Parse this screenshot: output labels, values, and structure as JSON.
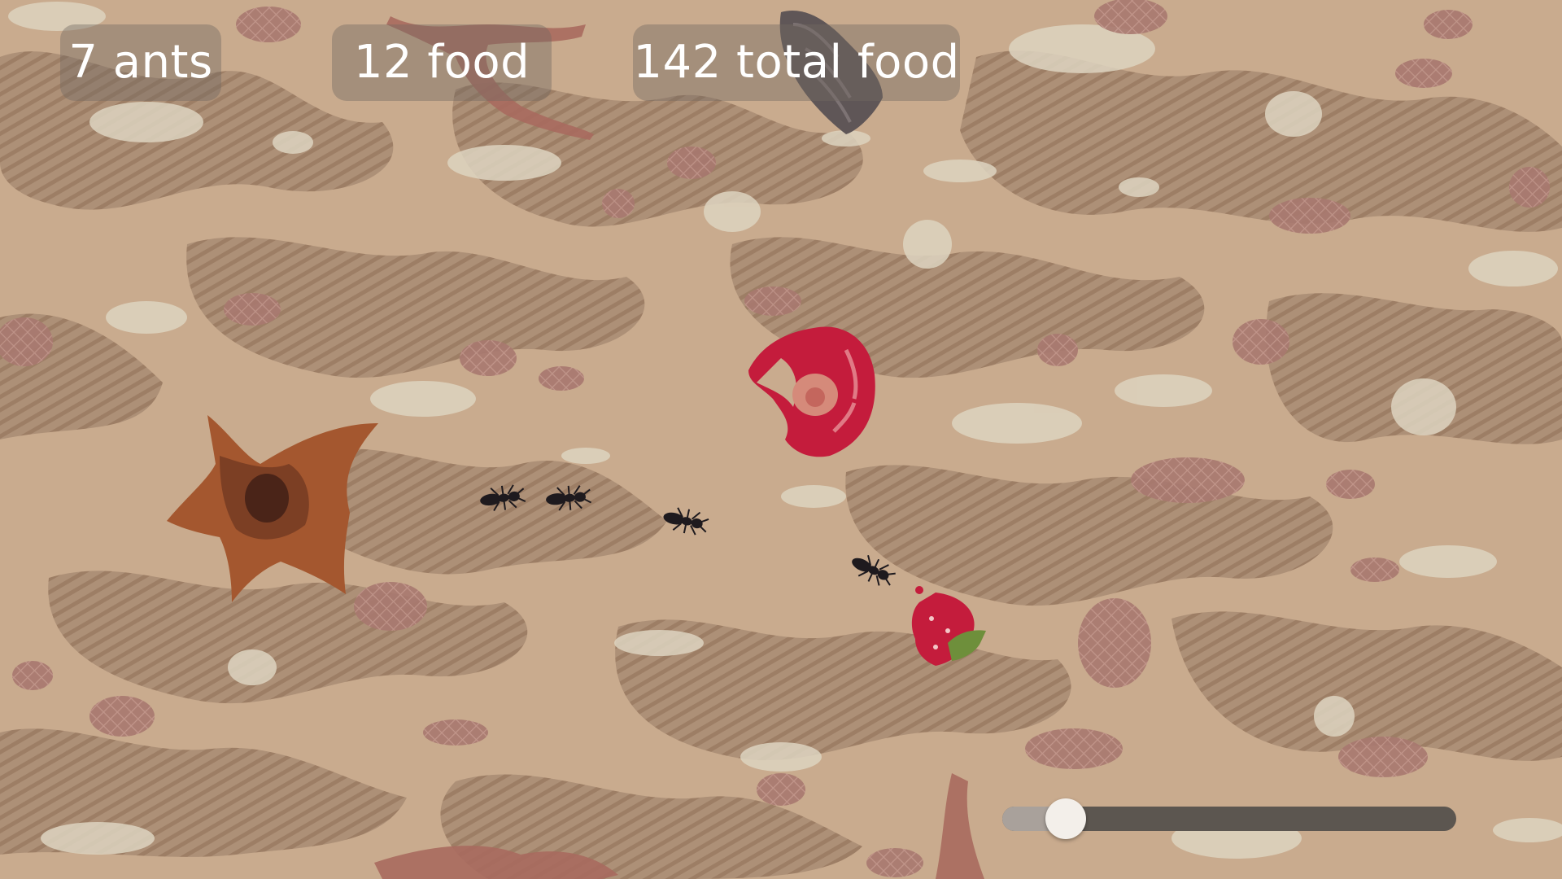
{
  "hud": {
    "ants": "7 ants",
    "food": "12 food",
    "total_food": "142 total food"
  },
  "speed_slider": {
    "level": 0.14
  },
  "colors": {
    "ground": "#c9ab8e",
    "ground_shadow": "#ad9077",
    "ground_light": "#ddd3bf",
    "pebble": "#a8786f",
    "nest": "#a4572f",
    "food_red": "#c41c3c",
    "ant": "#1e1a1e"
  },
  "scene_icons": [
    "ant-nest-icon",
    "ant-icon",
    "food-icon",
    "strawberry-icon",
    "rock-icon",
    "root-icon"
  ]
}
